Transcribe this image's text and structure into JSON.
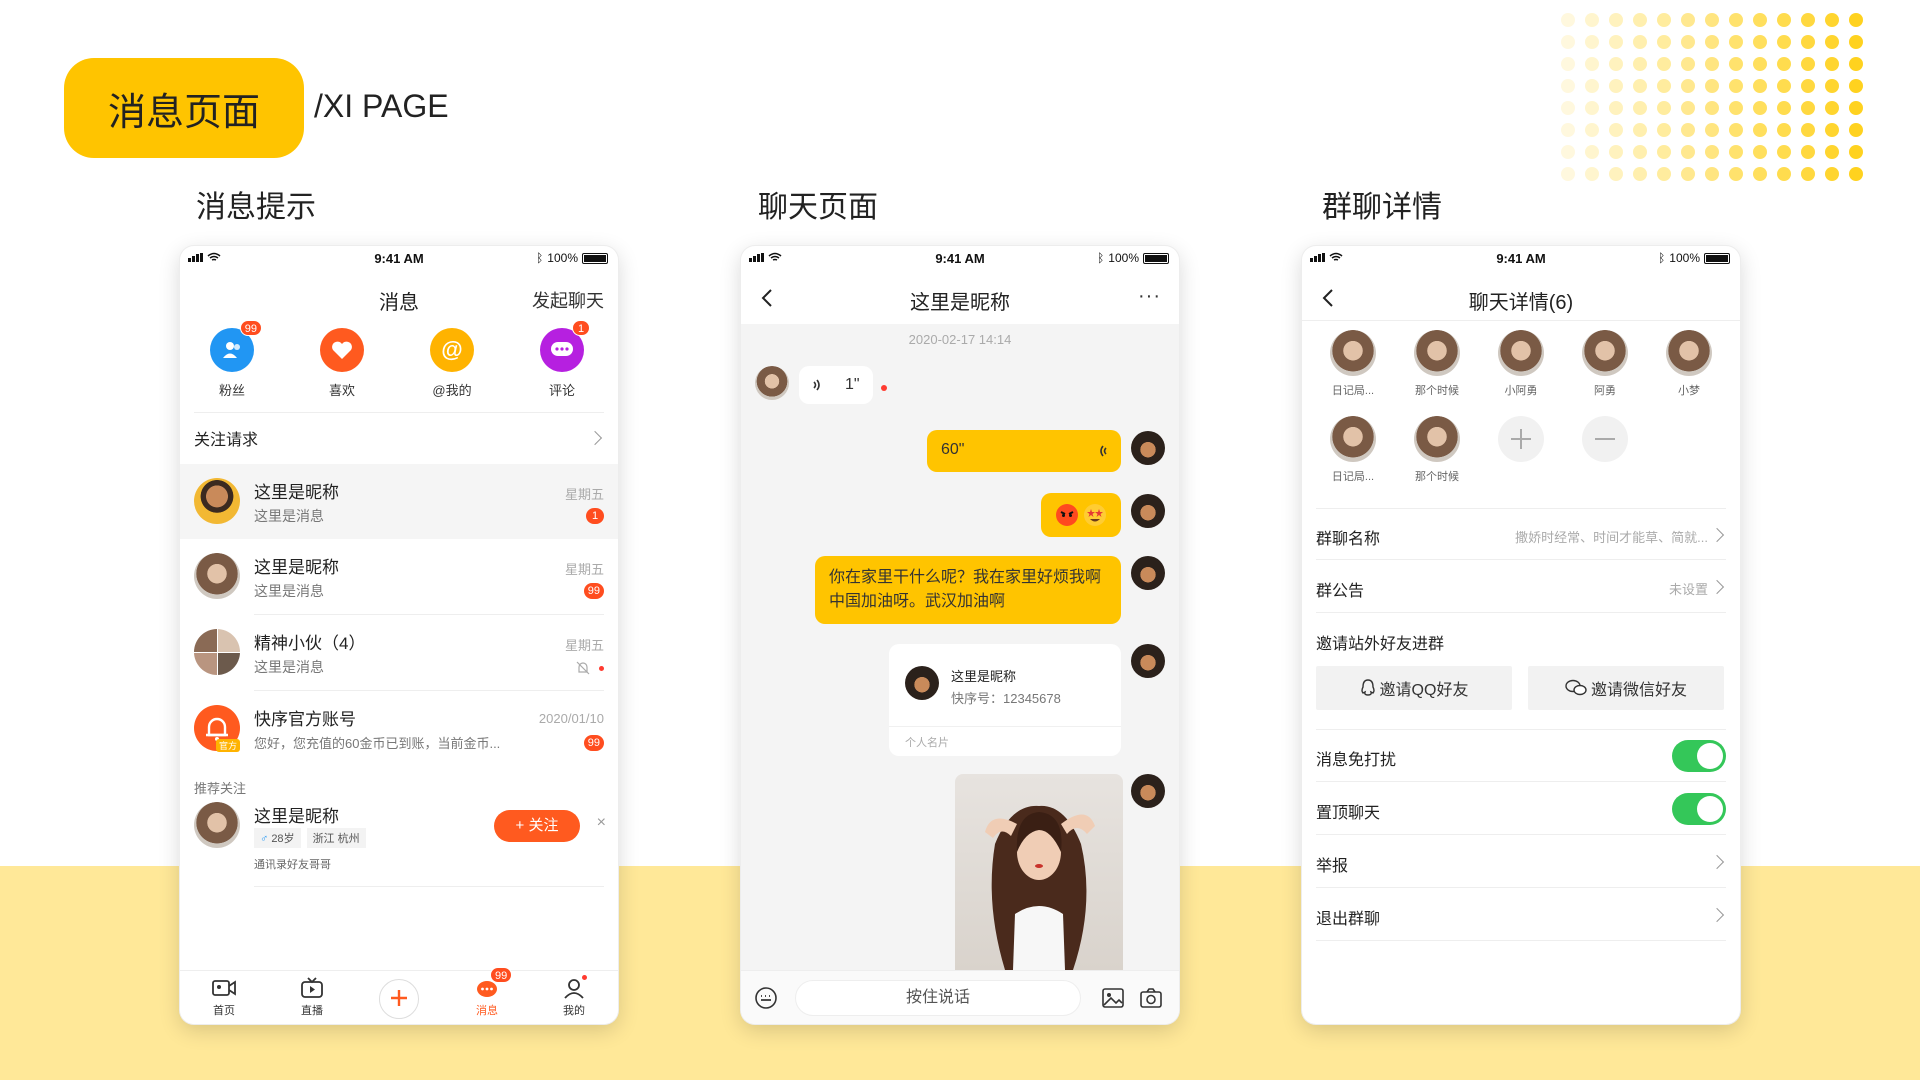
{
  "header": {
    "badge_title": "消息页面",
    "subtitle": "/XI PAGE"
  },
  "sections": [
    "消息提示",
    "聊天页面",
    "群聊详情"
  ],
  "status_bar": {
    "time": "9:41 AM",
    "battery": "100%"
  },
  "messages_screen": {
    "title": "消息",
    "start_chat": "发起聊天",
    "quick_entries": [
      {
        "label": "粉丝",
        "icon": "fans-icon",
        "badge": "99",
        "color": "#2196f3"
      },
      {
        "label": "喜欢",
        "icon": "heart-icon",
        "badge": "",
        "color": "#ff5a1f"
      },
      {
        "label": "@我的",
        "icon": "at-icon",
        "badge": "",
        "color": "#ffb300"
      },
      {
        "label": "评论",
        "icon": "comment-icon",
        "badge": "1",
        "color": "#b620e0"
      }
    ],
    "follow_requests": "关注请求",
    "conversations": [
      {
        "name": "这里是昵称",
        "preview": "这里是消息",
        "time": "星期五",
        "badge": "1"
      },
      {
        "name": "这里是昵称",
        "preview": "这里是消息",
        "time": "星期五",
        "badge": "99"
      },
      {
        "name": "精神小伙（4）",
        "preview": "这里是消息",
        "time": "星期五",
        "badge": ""
      },
      {
        "name": "快序官方账号",
        "preview": "您好，您充值的60金币已到账，当前金币...",
        "time": "2020/01/10",
        "badge": "99",
        "tag": "官方"
      }
    ],
    "recommend": {
      "section": "推荐关注",
      "name": "这里是昵称",
      "age": "28岁",
      "location": "浙江 杭州",
      "reason": "通讯录好友哥哥",
      "follow": "+ 关注",
      "close": "×"
    },
    "tabs": [
      {
        "label": "首页",
        "icon": "camera-icon"
      },
      {
        "label": "直播",
        "icon": "tv-icon"
      },
      {
        "label": "",
        "icon": "add-icon"
      },
      {
        "label": "消息",
        "icon": "message-icon",
        "badge": "99"
      },
      {
        "label": "我的",
        "icon": "profile-icon"
      }
    ]
  },
  "chat_screen": {
    "title": "这里是昵称",
    "more": "···",
    "timestamp": "2020-02-17 14:14",
    "incoming_voice": "1\"",
    "outgoing_voice": "60\"",
    "text_message": "你在家里干什么呢？我在家里好烦我啊中国加油呀。武汉加油啊",
    "card": {
      "name": "这里是昵称",
      "id": "快序号：12345678",
      "type": "个人名片"
    },
    "press_to_talk": "按住说话"
  },
  "group_screen": {
    "title": "聊天详情(6)",
    "members": [
      "日记局...",
      "那个时候",
      "小阿勇",
      "阿勇",
      "小梦",
      "日记局...",
      "那个时候"
    ],
    "group_name_label": "群聊名称",
    "group_name_value": "撒娇时经常、时间才能草、简就...",
    "notice_label": "群公告",
    "notice_value": "未设置",
    "invite_label": "邀请站外好友进群",
    "invite_qq": "邀请QQ好友",
    "invite_wechat": "邀请微信好友",
    "mute_label": "消息免打扰",
    "mute_on": true,
    "pin_label": "置顶聊天",
    "pin_on": true,
    "report_label": "举报",
    "exit_label": "退出群聊"
  },
  "colors": {
    "accent": "#ffc400",
    "orange": "#ff5a1f",
    "toggle": "#34c759",
    "band": "#ffe898"
  }
}
